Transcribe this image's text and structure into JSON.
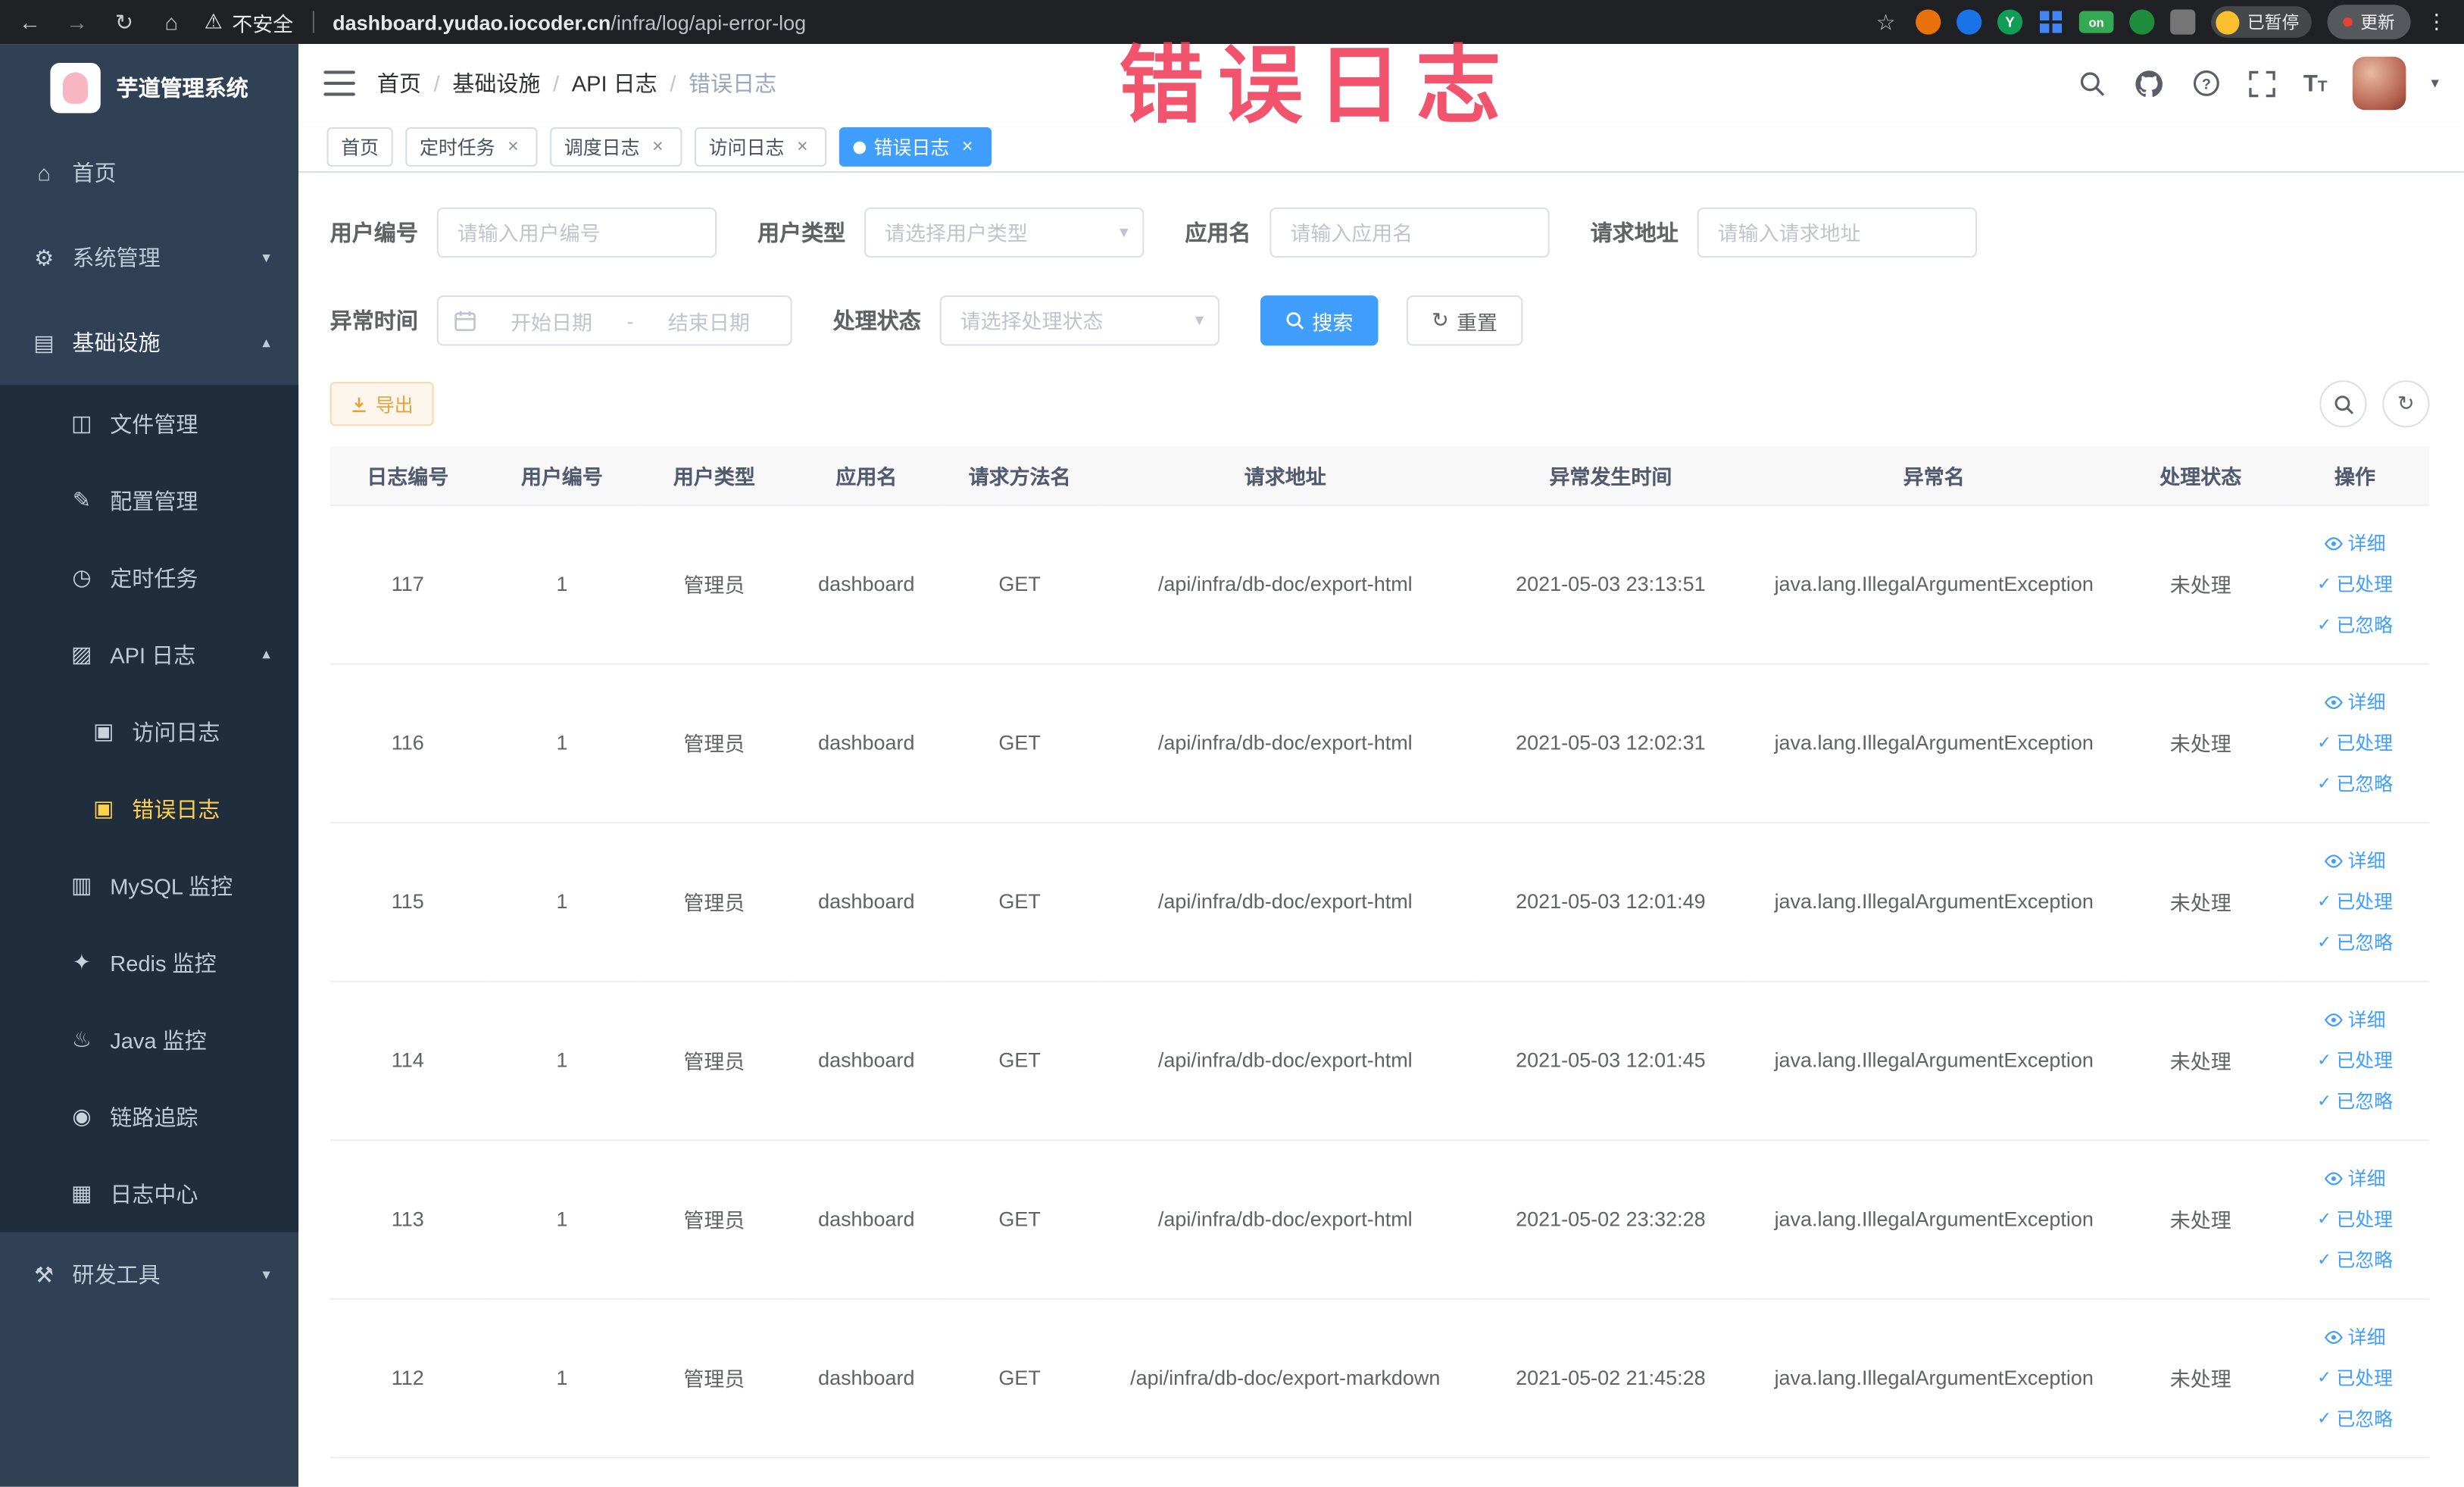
{
  "watermark": "错误日志",
  "icons": {
    "close": "×",
    "chevron_down": "▾",
    "chevron_up": "▴",
    "check": "✓",
    "refresh": "↻",
    "back": "←",
    "forward": "→",
    "reload": "↻",
    "home": "⌂",
    "warning": "⚠",
    "star": "☆",
    "dots": "⋮",
    "caret_down": "▾",
    "date_separator": "-"
  },
  "browser": {
    "security_label": "不安全",
    "url_domain": "dashboard.yudao.iocoder.cn",
    "url_path": "/infra/log/api-error-log",
    "ext_y": "Y",
    "ext_on": "on",
    "paused_badge": "已暂停",
    "update_button": "更新"
  },
  "sidebar": {
    "logo_title": "芋道管理系统",
    "menu": [
      {
        "label": "首页",
        "icon": "⌂"
      },
      {
        "label": "系统管理",
        "icon": "⚙"
      },
      {
        "label": "基础设施",
        "icon": "▤"
      },
      {
        "label": "文件管理",
        "icon": "◫"
      },
      {
        "label": "配置管理",
        "icon": "✎"
      },
      {
        "label": "定时任务",
        "icon": "◷"
      },
      {
        "label": "API 日志",
        "icon": "▨"
      },
      {
        "label": "访问日志",
        "icon": "▣"
      },
      {
        "label": "错误日志",
        "icon": "▣"
      },
      {
        "label": "MySQL 监控",
        "icon": "▥"
      },
      {
        "label": "Redis 监控",
        "icon": "✦"
      },
      {
        "label": "Java 监控",
        "icon": "♨"
      },
      {
        "label": "链路追踪",
        "icon": "◉"
      },
      {
        "label": "日志中心",
        "icon": "▦"
      },
      {
        "label": "研发工具",
        "icon": "⚒"
      }
    ]
  },
  "header": {
    "breadcrumb": [
      "首页",
      "基础设施",
      "API 日志",
      "错误日志"
    ],
    "breadcrumb_separator": "/"
  },
  "tabs": [
    {
      "label": "首页"
    },
    {
      "label": "定时任务"
    },
    {
      "label": "调度日志"
    },
    {
      "label": "访问日志"
    },
    {
      "label": "错误日志"
    }
  ],
  "filters": {
    "user_id": {
      "label": "用户编号",
      "placeholder": "请输入用户编号"
    },
    "user_type": {
      "label": "用户类型",
      "placeholder": "请选择用户类型"
    },
    "app_name": {
      "label": "应用名",
      "placeholder": "请输入应用名"
    },
    "request_url": {
      "label": "请求地址",
      "placeholder": "请输入请求地址"
    },
    "exception_time": {
      "label": "异常时间",
      "start_placeholder": "开始日期",
      "end_placeholder": "结束日期"
    },
    "process_status": {
      "label": "处理状态",
      "placeholder": "请选择处理状态"
    },
    "search_button": "搜索",
    "reset_button": "重置"
  },
  "toolbar": {
    "export_button": "导出"
  },
  "table": {
    "columns": [
      "日志编号",
      "用户编号",
      "用户类型",
      "应用名",
      "请求方法名",
      "请求地址",
      "异常发生时间",
      "异常名",
      "处理状态",
      "操作"
    ],
    "actions": {
      "detail": "详细",
      "processed": "已处理",
      "ignored": "已忽略"
    },
    "rows": [
      {
        "id": "117",
        "user_id": "1",
        "user_type": "管理员",
        "app": "dashboard",
        "method": "GET",
        "url": "/api/infra/db-doc/export-html",
        "time": "2021-05-03 23:13:51",
        "exception": "java.lang.IllegalArgumentException",
        "status": "未处理"
      },
      {
        "id": "116",
        "user_id": "1",
        "user_type": "管理员",
        "app": "dashboard",
        "method": "GET",
        "url": "/api/infra/db-doc/export-html",
        "time": "2021-05-03 12:02:31",
        "exception": "java.lang.IllegalArgumentException",
        "status": "未处理"
      },
      {
        "id": "115",
        "user_id": "1",
        "user_type": "管理员",
        "app": "dashboard",
        "method": "GET",
        "url": "/api/infra/db-doc/export-html",
        "time": "2021-05-03 12:01:49",
        "exception": "java.lang.IllegalArgumentException",
        "status": "未处理"
      },
      {
        "id": "114",
        "user_id": "1",
        "user_type": "管理员",
        "app": "dashboard",
        "method": "GET",
        "url": "/api/infra/db-doc/export-html",
        "time": "2021-05-03 12:01:45",
        "exception": "java.lang.IllegalArgumentException",
        "status": "未处理"
      },
      {
        "id": "113",
        "user_id": "1",
        "user_type": "管理员",
        "app": "dashboard",
        "method": "GET",
        "url": "/api/infra/db-doc/export-html",
        "time": "2021-05-02 23:32:28",
        "exception": "java.lang.IllegalArgumentException",
        "status": "未处理"
      },
      {
        "id": "112",
        "user_id": "1",
        "user_type": "管理员",
        "app": "dashboard",
        "method": "GET",
        "url": "/api/infra/db-doc/export-markdown",
        "time": "2021-05-02 21:45:28",
        "exception": "java.lang.IllegalArgumentException",
        "status": "未处理"
      }
    ]
  },
  "colors": {
    "accent": "#409eff",
    "warning": "#e6a23c",
    "sidebar_bg": "#304156",
    "submenu_bg": "#1f2d3d",
    "active_menu_text": "#ffd04b",
    "watermark": "#f03c5a",
    "chrome_bg": "#202124"
  }
}
